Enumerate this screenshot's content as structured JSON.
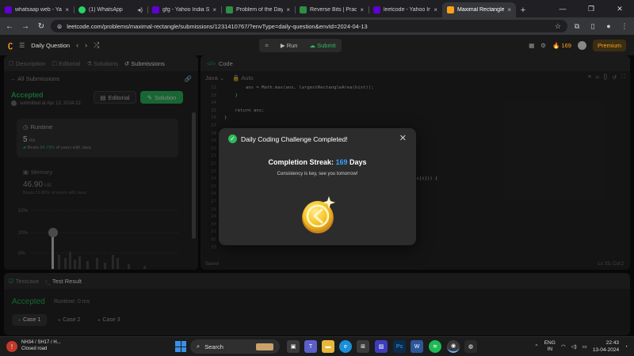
{
  "browser": {
    "tabs": [
      {
        "title": "whatsaap web - Yaho",
        "icon": "yahoo-icon",
        "color": "#6001d2"
      },
      {
        "title": "(1) WhatsApp",
        "icon": "whatsapp-icon",
        "color": "#25d366"
      },
      {
        "title": "gfg - Yahoo India Se",
        "icon": "yahoo-icon",
        "color": "#6001d2"
      },
      {
        "title": "Problem of the Day |",
        "icon": "gfg-icon",
        "color": "#2f8d46"
      },
      {
        "title": "Reverse Bits | Practic",
        "icon": "gfg-icon",
        "color": "#2f8d46"
      },
      {
        "title": "leetcode - Yahoo Indi",
        "icon": "yahoo-icon",
        "color": "#6001d2"
      },
      {
        "title": "Maximal Rectangle",
        "icon": "leetcode-icon",
        "color": "#ffa116",
        "active": true
      }
    ],
    "url": "leetcode.com/problems/maximal-rectangle/submissions/1231410767/?envType=daily-question&envId=2024-04-13"
  },
  "lc_nav": {
    "title": "Daily Question",
    "run": "Run",
    "submit": "Submit",
    "streak": "169",
    "premium": "Premium"
  },
  "left": {
    "tabs": [
      "Description",
      "Editorial",
      "Solutions",
      "Submissions"
    ],
    "back": "All Submissions",
    "status": "Accepted",
    "submitted": "submitted at Apr 13, 2024 22:",
    "editorial_btn": "Editorial",
    "solution_btn": "Solution",
    "runtime_label": "Runtime",
    "runtime_value": "5",
    "runtime_unit": "ms",
    "runtime_beats_pre": "Beats",
    "runtime_beats": "84.79%",
    "runtime_beats_post": "of users with Java",
    "memory_label": "Memory",
    "memory_value": "46.90",
    "memory_unit": "MB",
    "memory_beats": "Beats 21.86% of users with Java",
    "dist_ticks": [
      "10%",
      "10%",
      "0%"
    ]
  },
  "code": {
    "header": "Code",
    "lang": "Java",
    "mode": "Auto",
    "lines": [
      {
        "n": "12",
        "t": "        ans = Math.max(ans, largestRectangleArea(hist));"
      },
      {
        "n": "13",
        "t": "    }"
      },
      {
        "n": "14",
        "t": ""
      },
      {
        "n": "15",
        "t": "    return ans;"
      },
      {
        "n": "16",
        "t": "}"
      },
      {
        "n": "17",
        "t": ""
      },
      {
        "n": "18",
        "t": ""
      },
      {
        "n": "19",
        "t": ""
      },
      {
        "n": "20",
        "t": ""
      },
      {
        "n": "21",
        "t": ""
      },
      {
        "n": "22",
        "t": ""
      },
      {
        "n": "23",
        "t": ""
      },
      {
        "n": "24",
        "t": "                                                  stack.peek()] > heights[i])) {"
      },
      {
        "n": "25",
        "t": ""
      },
      {
        "n": "26",
        "t": ""
      },
      {
        "n": "27",
        "t": ""
      },
      {
        "n": "28",
        "t": ""
      },
      {
        "n": "29",
        "t": ""
      },
      {
        "n": "30",
        "t": ""
      },
      {
        "n": "31",
        "t": ""
      },
      {
        "n": "32",
        "t": ""
      },
      {
        "n": "33",
        "t": ""
      }
    ],
    "saved": "Saved",
    "position": "Ln 33, Col 2"
  },
  "bottom": {
    "tabs": [
      "Testcase",
      "Test Result"
    ],
    "status": "Accepted",
    "runtime": "Runtime: 0 ms",
    "cases": [
      "Case 1",
      "Case 2",
      "Case 3"
    ]
  },
  "modal": {
    "title": "Daily Coding Challenge Completed!",
    "streak_label": "Completion Streak:",
    "streak_value": "169",
    "streak_unit": "Days",
    "subtitle": "Consistency is key, see you tomorrow!"
  },
  "taskbar": {
    "weather_line1": "NH34 / SH17 / H...",
    "weather_line2": "Closed road",
    "search": "Search",
    "lang1": "ENG",
    "lang2": "IN",
    "time": "22:43",
    "date": "13-04-2024"
  },
  "colors": {
    "accent": "#2cbb5d",
    "brand": "#ffa116",
    "streak": "#3b9fff"
  }
}
